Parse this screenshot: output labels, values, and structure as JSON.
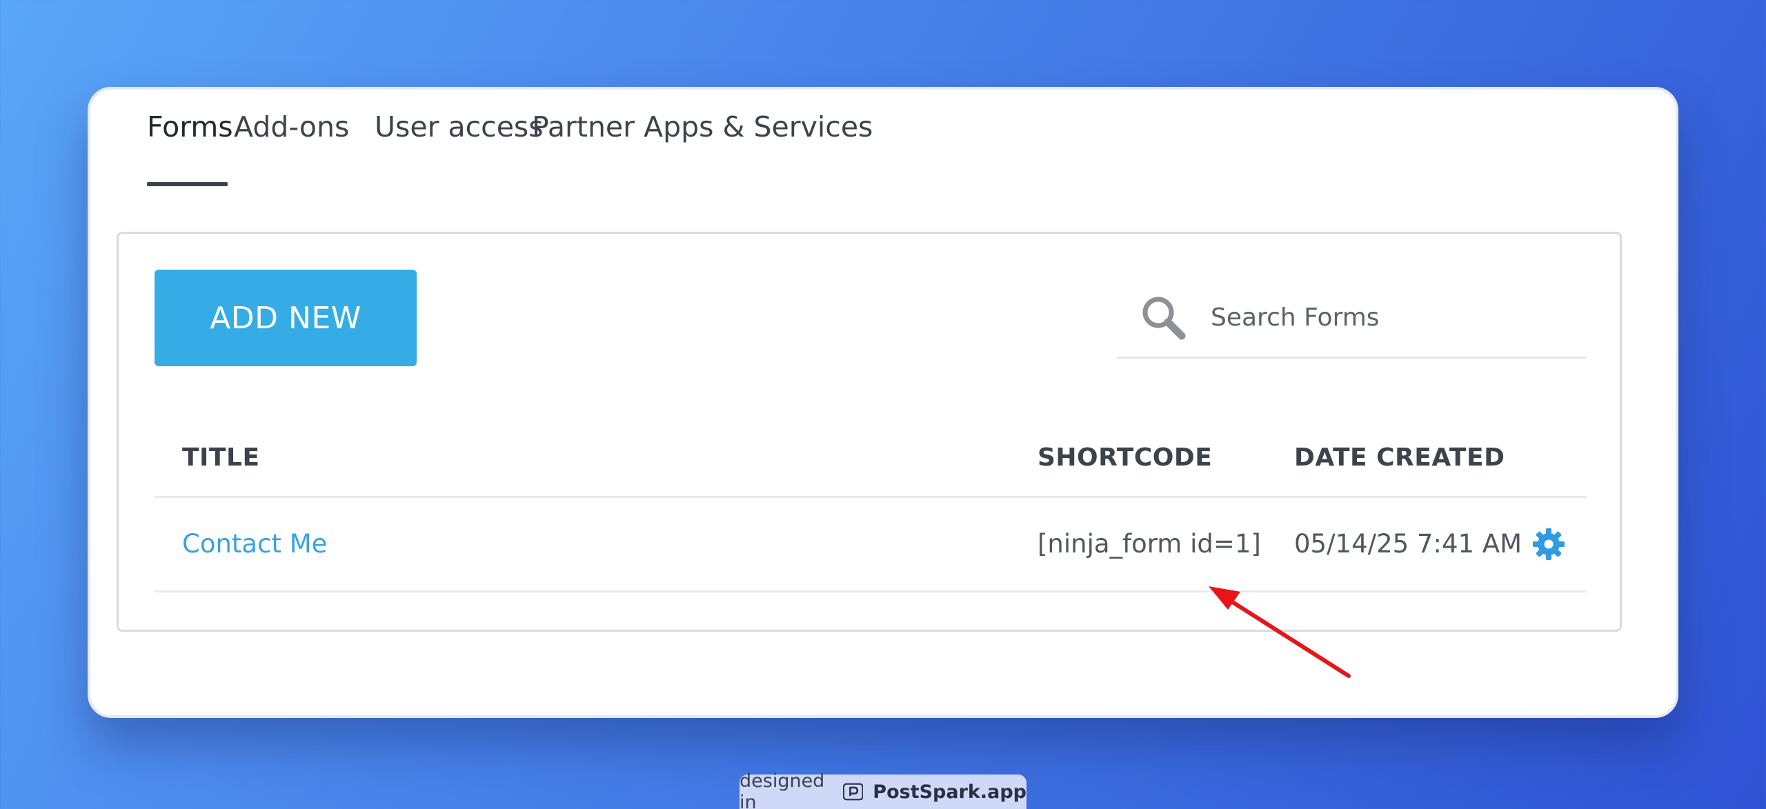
{
  "tabs": [
    {
      "label": "Forms",
      "active": true
    },
    {
      "label": "Add-ons",
      "active": false
    },
    {
      "label": "User access",
      "active": false
    },
    {
      "label": "Partner Apps & Services",
      "active": false
    }
  ],
  "toolbar": {
    "add_new_label": "ADD NEW"
  },
  "search": {
    "placeholder": "Search Forms",
    "value": ""
  },
  "table": {
    "columns": {
      "title": "TITLE",
      "shortcode": "SHORTCODE",
      "date_created": "DATE CREATED"
    },
    "rows": [
      {
        "title": "Contact Me",
        "shortcode": "[ninja_form id=1]",
        "date_created": "05/14/25 7:41 AM",
        "action_icon": "gear-icon"
      }
    ]
  },
  "annotation": {
    "arrow_color": "#e8141a"
  },
  "credit": {
    "prefix": "designed in",
    "brand": "PostSpark.app"
  },
  "colors": {
    "accent": "#36ace6",
    "link": "#3aa1e3",
    "gear": "#2f9be0"
  }
}
